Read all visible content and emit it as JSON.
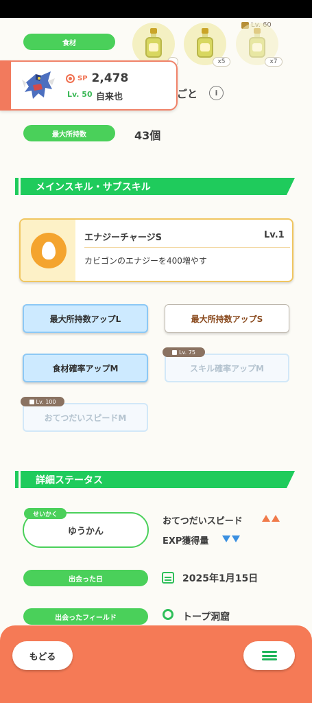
{
  "ingredient": {
    "label": "食材",
    "items": [
      {
        "name": "ingredient-1",
        "count": ""
      },
      {
        "name": "ingredient-2",
        "count": "x5"
      },
      {
        "name": "ingredient-3",
        "count": "x7",
        "unlock_level": "Lv. 60"
      }
    ]
  },
  "popup": {
    "sp_label": "SP",
    "sp_value": "2,478",
    "level": "Lv. 50",
    "name": "自来也",
    "behind_text": "ごと"
  },
  "max_carry": {
    "label": "最大所持数",
    "value": "43個"
  },
  "skills_section": {
    "title": "メインスキル・サブスキル"
  },
  "main_skill": {
    "name": "エナジーチャージS",
    "level": "Lv.1",
    "description": "カビゴンのエナジーを400増やす"
  },
  "sub_skills": [
    {
      "label": "最大所持数アップL",
      "state": "active"
    },
    {
      "label": "最大所持数アップS",
      "state": "normal"
    },
    {
      "label": "食材確率アップM",
      "state": "active"
    },
    {
      "label": "スキル確率アップM",
      "state": "locked",
      "unlock": "Lv. 75"
    },
    {
      "label": "おてつだいスピードM",
      "state": "locked",
      "unlock": "Lv. 100"
    }
  ],
  "detail_section": {
    "title": "詳細ステータス"
  },
  "nature": {
    "tag": "せいかく",
    "value": "ゆうかん",
    "up_label": "おてつだいスピード",
    "down_label": "EXP獲得量"
  },
  "met_date": {
    "label": "出会った日",
    "value": "2025年1月15日"
  },
  "met_field": {
    "label": "出会ったフィールド",
    "value": "トープ洞窟"
  },
  "footer": {
    "back_label": "もどる"
  },
  "colors": {
    "accent_green": "#1fcb5c",
    "accent_orange": "#f57a56",
    "up_color": "#f07a4a",
    "down_color": "#3a8fe0"
  }
}
